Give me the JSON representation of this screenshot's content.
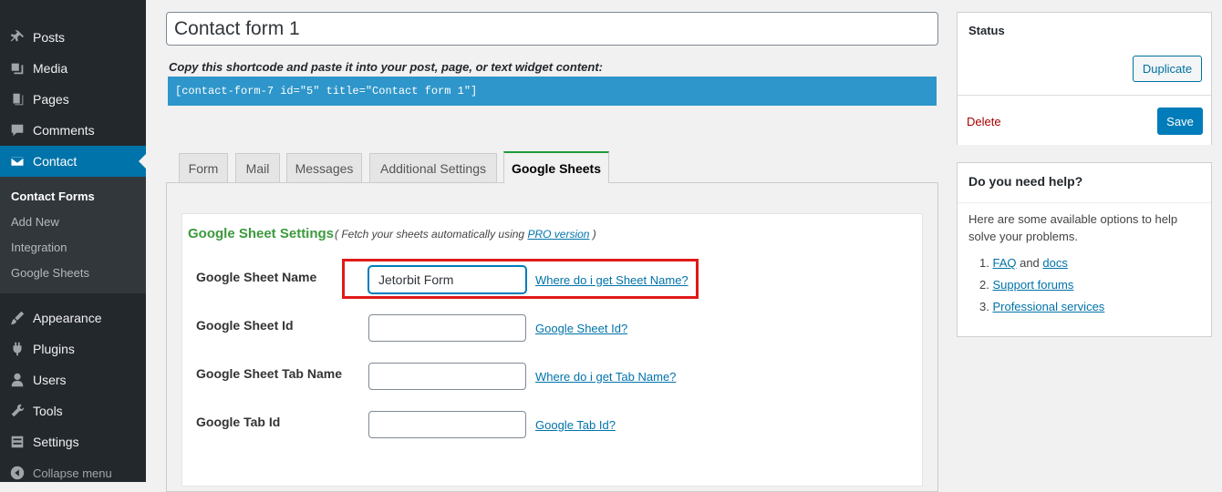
{
  "sidebar": {
    "items": [
      {
        "label": "Posts",
        "icon": "pin-icon"
      },
      {
        "label": "Media",
        "icon": "media-icon"
      },
      {
        "label": "Pages",
        "icon": "pages-icon"
      },
      {
        "label": "Comments",
        "icon": "comment-icon"
      },
      {
        "label": "Contact",
        "icon": "mail-icon"
      },
      {
        "label": "Appearance",
        "icon": "brush-icon"
      },
      {
        "label": "Plugins",
        "icon": "plugin-icon"
      },
      {
        "label": "Users",
        "icon": "user-icon"
      },
      {
        "label": "Tools",
        "icon": "wrench-icon"
      },
      {
        "label": "Settings",
        "icon": "settings-icon"
      }
    ],
    "submenu": [
      "Contact Forms",
      "Add New",
      "Integration",
      "Google Sheets"
    ],
    "collapse_label": "Collapse menu"
  },
  "form": {
    "title": "Contact form 1",
    "shortcode_label": "Copy this shortcode and paste it into your post, page, or text widget content:",
    "shortcode": "[contact-form-7 id=\"5\" title=\"Contact form 1\"]"
  },
  "tabs": [
    "Form",
    "Mail",
    "Messages",
    "Additional Settings",
    "Google Sheets"
  ],
  "settings": {
    "title": "Google Sheet Settings",
    "subtitle_before": "( Fetch your sheets automatically using ",
    "subtitle_link": "PRO version",
    "subtitle_after": " )",
    "fields": [
      {
        "label": "Google Sheet Name",
        "value": "Jetorbit Form",
        "link": "Where do i get Sheet Name?"
      },
      {
        "label": "Google Sheet Id",
        "value": "",
        "link": "Google Sheet Id?"
      },
      {
        "label": "Google Sheet Tab Name",
        "value": "",
        "link": "Where do i get Tab Name?"
      },
      {
        "label": "Google Tab Id",
        "value": "",
        "link": "Google Tab Id?"
      }
    ]
  },
  "status": {
    "title": "Status",
    "duplicate_label": "Duplicate",
    "delete_label": "Delete",
    "save_label": "Save"
  },
  "help": {
    "title": "Do you need help?",
    "text": "Here are some available options to help solve your problems.",
    "item1_num": "1.",
    "item1_link_a": "FAQ",
    "item1_and": " and ",
    "item1_link_b": "docs",
    "item2_num": "2.",
    "item2_link": "Support forums",
    "item3_num": "3.",
    "item3_link": "Professional services"
  },
  "colors": {
    "accent": "#0073aa",
    "shortcode_bg": "#2e96ca",
    "settings_title": "#3c9a3d",
    "highlight": "#e11919"
  }
}
